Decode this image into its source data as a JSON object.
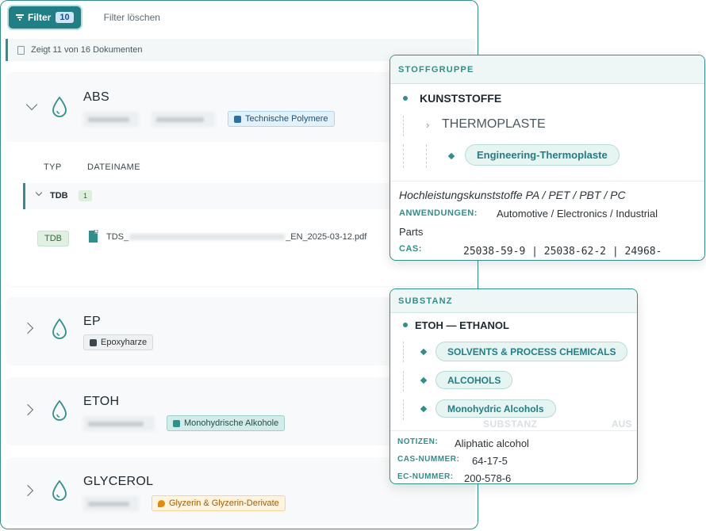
{
  "toolbar": {
    "filter_label": "Filter",
    "filter_count": "10",
    "clear_label": "Filter löschen"
  },
  "info": {
    "text": "Zeigt 11 von 16 Dokumenten"
  },
  "groups": [
    {
      "title": "ABS",
      "tag": "Technische Polymere",
      "expanded": true
    },
    {
      "title": "EP",
      "tag": "Epoxyharze",
      "expanded": false
    },
    {
      "title": "ETOH",
      "tag": "Monohydrische Alkohole",
      "expanded": false
    },
    {
      "title": "GLYCEROL",
      "tag": "Glyzerin & Glyzerin-Derivate",
      "expanded": false
    }
  ],
  "table": {
    "col_type": "TYP",
    "col_filename": "DATEINAME",
    "subgroup_label": "TDB",
    "subgroup_count": "1",
    "row_type": "TDB",
    "file_prefix": "TDS_",
    "file_suffix": "_EN_2025-03-12.pdf"
  },
  "stoffgruppe": {
    "header": "STOFFGRUPPE",
    "level1": "KUNSTSTOFFE",
    "level2": "THERMOPLASTE",
    "level3": "Engineering-Thermoplaste",
    "description": "Hochleistungskunststoffe PA / PET / PBT / PC",
    "anwendungen_label": "ANWENDUNGEN:",
    "anwendungen_value": "Automotive / Electronics / Industrial",
    "anwendungen_value_cont": "Parts",
    "cas_label": "CAS:",
    "cas_value": "25038-59-9 | 25038-62-2 | 24968-"
  },
  "substanz": {
    "header": "SUBSTANZ",
    "name": "ETOH — ETHANOL",
    "categories": [
      "SOLVENTS & PROCESS CHEMICALS",
      "ALCOHOLS",
      "Monohydric Alcohols"
    ],
    "ghost_col1": "SUBSTANZ",
    "ghost_col2": "AUS",
    "notizen_label": "NOTIZEN:",
    "notizen_value": "Aliphatic alcohol",
    "cas_label": "CAS-NUMMER:",
    "cas_value": "64-17-5",
    "ec_label": "EC-NUMMER:",
    "ec_value": "200-578-6"
  },
  "colors": {
    "accent": "#2f8f8a",
    "filter_button": "#1f7f84"
  }
}
